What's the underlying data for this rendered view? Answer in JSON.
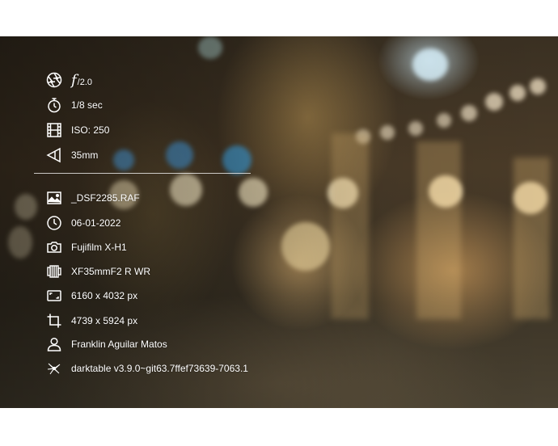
{
  "exposure": {
    "aperture_symbol": "f",
    "aperture_value": "/2.0",
    "shutter": "1/8 sec",
    "iso": "ISO: 250",
    "focal_length": "35mm"
  },
  "file": {
    "filename": "_DSF2285.RAF",
    "date": "06-01-2022",
    "camera": "Fujifilm X-H1",
    "lens": "XF35mmF2 R WR",
    "dimensions": "6160 x 4032 px",
    "crop": "4739 x 5924 px",
    "author": "Franklin Aguilar Matos",
    "software": "darktable v3.9.0~git63.7ffef73639-7063.1"
  },
  "icons": {
    "aperture": "aperture-icon",
    "shutter": "stopwatch-icon",
    "iso": "film-icon",
    "focal": "lens-angle-icon",
    "file": "image-icon",
    "date": "clock-icon",
    "camera": "camera-icon",
    "lens": "lens-icon",
    "dimensions": "frame-icon",
    "crop": "crop-icon",
    "author": "person-icon",
    "software": "darktable-icon"
  },
  "colors": {
    "text": "#ffffff",
    "border": "#ffffff"
  }
}
